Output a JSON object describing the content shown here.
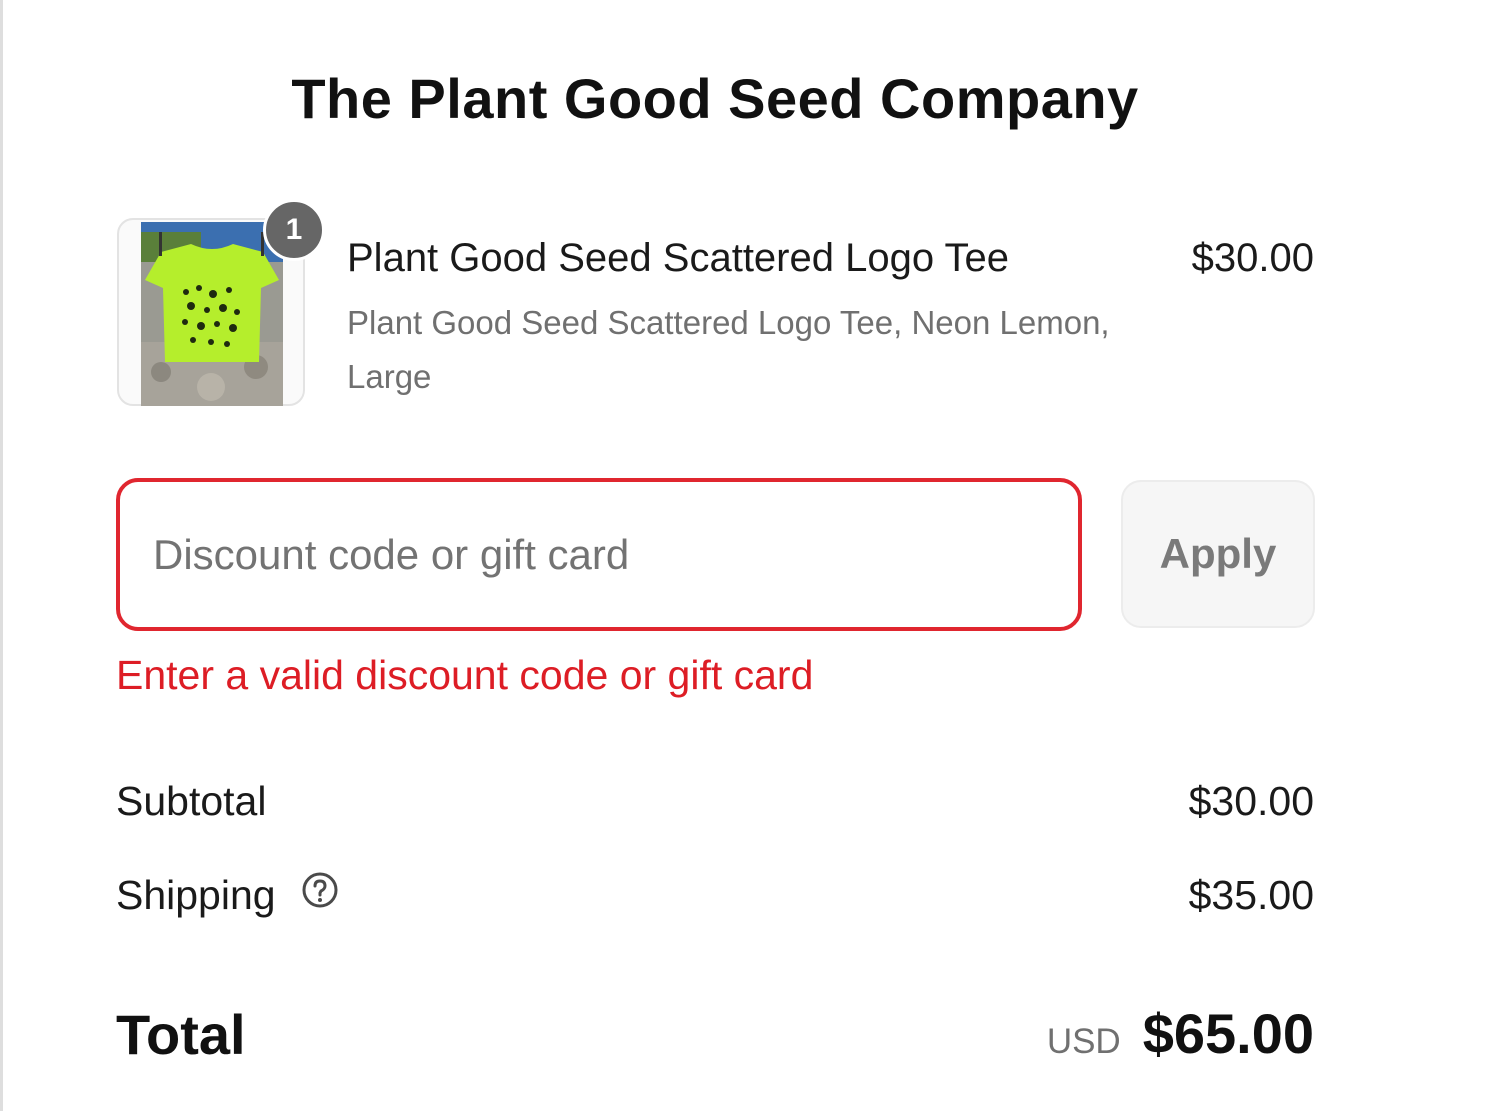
{
  "store": {
    "title": "The Plant Good Seed Company"
  },
  "line_item": {
    "quantity": "1",
    "name": "Plant Good Seed Scattered Logo Tee",
    "variant": "Plant Good Seed Scattered Logo Tee, Neon Lemon, Large",
    "price": "$30.00",
    "image_icon": "tshirt-photo"
  },
  "discount": {
    "placeholder": "Discount code or gift card",
    "value": "",
    "apply_label": "Apply",
    "error": "Enter a valid discount code or gift card"
  },
  "summary": {
    "subtotal_label": "Subtotal",
    "subtotal_value": "$30.00",
    "shipping_label": "Shipping",
    "shipping_value": "$35.00",
    "help_icon": "question-circle-icon",
    "total_label": "Total",
    "currency": "USD",
    "total_value": "$65.00"
  },
  "colors": {
    "error_red": "#e0262f",
    "shirt": "#b5ee2c"
  }
}
